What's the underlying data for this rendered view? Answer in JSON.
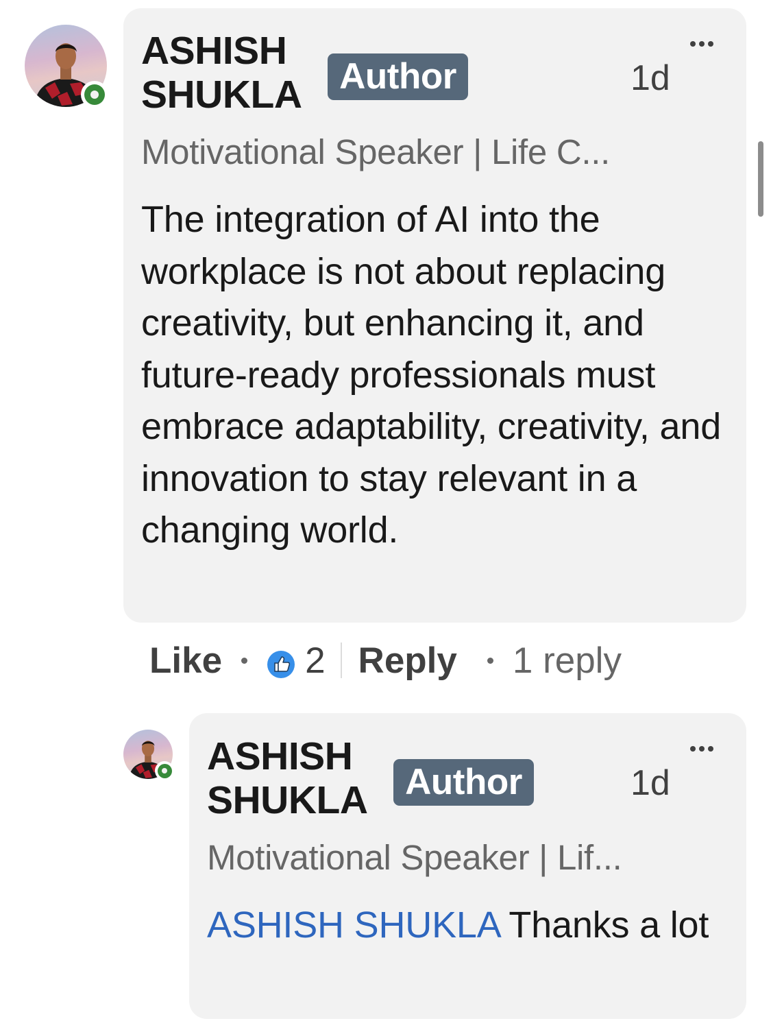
{
  "comment": {
    "author_name_line1": "ASHISH",
    "author_name_line2": "SHUKLA",
    "badge": "Author",
    "time": "1d",
    "headline": "Motivational Speaker | Life C...",
    "text": "The integration of AI into the workplace is not about replacing creativity, but enhancing it, and future-ready professionals must embrace adaptability, creativity, and innovation to stay relevant in a changing world.",
    "more_icon": "more-horizontal-icon"
  },
  "actions": {
    "like_label": "Like",
    "reaction_icon": "like-thumb-icon",
    "reaction_count": "2",
    "reply_label": "Reply",
    "reply_count": "1 reply"
  },
  "reply": {
    "author_name_line1": "ASHISH",
    "author_name_line2": "SHUKLA",
    "badge": "Author",
    "time": "1d",
    "headline": "Motivational Speaker | Lif...",
    "mention": "ASHISH SHUKLA",
    "text": " Thanks a lot",
    "more_icon": "more-horizontal-icon"
  },
  "colors": {
    "bubble": "#f2f2f2",
    "badge": "#56687a",
    "mention": "#2e66be",
    "reaction_blue": "#378fe9",
    "online_green": "#378a3a"
  }
}
